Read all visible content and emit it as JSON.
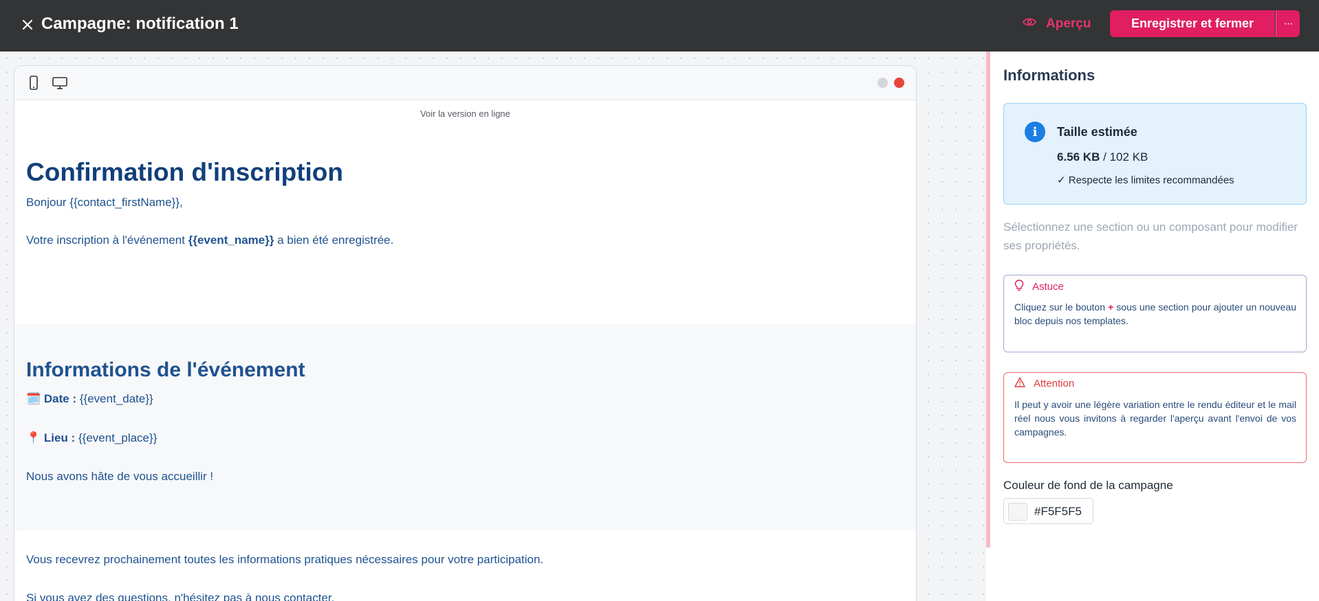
{
  "header": {
    "title": "Campagne: notification 1",
    "preview_label": "Aperçu",
    "save_label": "Enregistrer et fermer",
    "more_label": "···"
  },
  "editor": {
    "view_online": "Voir la version en ligne",
    "section1": {
      "title": "Confirmation d'inscription",
      "greeting": "Bonjour {{contact_firstName}},",
      "line_prefix": "Votre inscription à l'événement ",
      "line_bold": "{{event_name}}",
      "line_suffix": " a bien été enregistrée."
    },
    "section2": {
      "title": "Informations de l'événement",
      "date_emoji": "🗓️",
      "date_label": "Date :",
      "date_value": " {{event_date}}",
      "place_emoji": "📍",
      "place_label": "Lieu :",
      "place_value": " {{event_place}}",
      "closing": "Nous avons hâte de vous accueillir !"
    },
    "section3": {
      "line1": "Vous recevrez prochainement toutes les informations pratiques nécessaires pour votre participation.",
      "line2": "Si vous avez des questions, n'hésitez pas à nous contacter."
    }
  },
  "panel": {
    "title": "Informations",
    "size_box": {
      "title": "Taille estimée",
      "current": "6.56 KB",
      "separator": " / ",
      "limit": "102 KB",
      "status": "✓ Respecte les limites recommandées"
    },
    "hint": "Sélectionnez une section ou un composant pour modifier ses propriétés.",
    "tip": {
      "title": "Astuce",
      "body_prefix": "Cliquez sur le bouton ",
      "body_plus": "+",
      "body_suffix": " sous une section pour ajouter un nouveau bloc depuis nos templates."
    },
    "warning": {
      "title": "Attention",
      "body": "Il peut y avoir une légère variation entre le rendu éditeur et le mail réel nous vous invitons à regarder l'aperçu avant l'envoi de vos campagnes."
    },
    "background_color": {
      "label": "Couleur de fond de la campagne",
      "value": "#F5F5F5"
    }
  },
  "colors": {
    "brand": "#e01e61",
    "topbar": "#333435",
    "heading": "#123f7a",
    "text": "#1f5290",
    "info_bg": "#e3f2fd"
  }
}
